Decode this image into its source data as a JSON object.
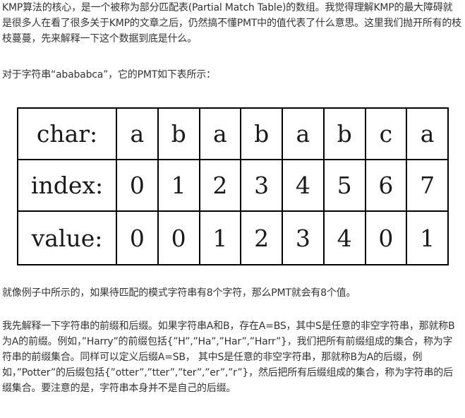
{
  "paragraphs": {
    "intro": "KMP算法的核心，是一个被称为部分匹配表(Partial Match Table)的数组。我觉得理解KMP的最大障碍就是很多人在看了很多关于KMP的文章之后，仍然搞不懂PMT中的值代表了什么意思。这里我们抛开所有的枝枝蔓蔓，先来解释一下这个数据到底是什么。",
    "table_intro": "对于字符串“abababca”，它的PMT如下表所示：",
    "after_table": "就像例子中所示的，如果待匹配的模式字符串有8个字符，那么PMT就会有8个值。",
    "explanation": "我先解释一下字符串的前缀和后缀。如果字符串A和B，存在A=BS，其中S是任意的非空字符串，那就称B为A的前缀。例如，”Harry”的前缀包括{”H”,”Ha”,”Har”,”Harr”}，我们把所有前缀组成的集合，称为字符串的前缀集合。同样可以定义后缀A=SB， 其中S是任意的非空字符串，那就称B为A的后缀，例如，”Potter”的后缀包括{”otter”,”tter”,”ter”,”er”,”r”}，然后把所有后缀组成的集合，称为字符串的后缀集合。要注意的是，字符串本身并不是自己的后缀。"
  },
  "pmt_table": {
    "rows": [
      {
        "header": "char:",
        "cells": [
          "a",
          "b",
          "a",
          "b",
          "a",
          "b",
          "c",
          "a"
        ]
      },
      {
        "header": "index:",
        "cells": [
          "0",
          "1",
          "2",
          "3",
          "4",
          "5",
          "6",
          "7"
        ]
      },
      {
        "header": "value:",
        "cells": [
          "0",
          "0",
          "1",
          "2",
          "3",
          "4",
          "0",
          "1"
        ]
      }
    ]
  }
}
